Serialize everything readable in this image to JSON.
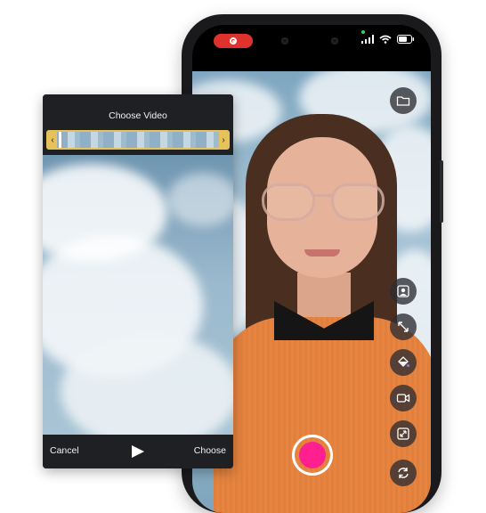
{
  "choose_video": {
    "title": "Choose Video",
    "cancel_label": "Cancel",
    "choose_label": "Choose"
  },
  "colors": {
    "record_pill": "#e0322c",
    "shutter": "#ff1f8e",
    "trim_handle": "#e5c35a"
  },
  "icons": {
    "top": "folder-icon",
    "controls": [
      "portrait-icon",
      "resize-icon",
      "fill-icon",
      "video-camera-icon",
      "fit-screen-icon",
      "refresh-icon"
    ]
  }
}
